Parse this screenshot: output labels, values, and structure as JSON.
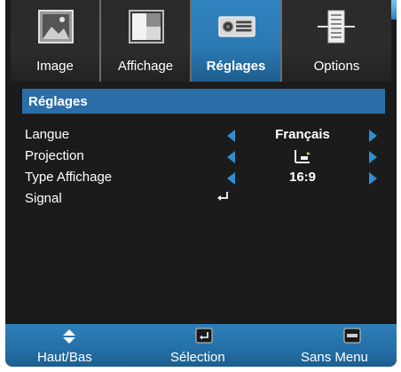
{
  "tabs": [
    {
      "label": "Image",
      "icon": "image-icon",
      "selected": false
    },
    {
      "label": "Affichage",
      "icon": "display-icon",
      "selected": false
    },
    {
      "label": "Réglages",
      "icon": "projector-icon",
      "selected": true
    },
    {
      "label": "Options",
      "icon": "options-icon",
      "selected": false
    }
  ],
  "panel": {
    "title": "Réglages",
    "rows": [
      {
        "label": "Langue",
        "value": "Français"
      },
      {
        "label": "Projection",
        "value": "",
        "value_icon": "projection-icon"
      },
      {
        "label": "Type Affichage",
        "value": "16:9"
      },
      {
        "label": "Signal",
        "value": "",
        "value_icon": "enter-icon"
      }
    ]
  },
  "bottom_bar": {
    "hints": [
      {
        "label": "Haut/Bas",
        "icon": "up-down-icon"
      },
      {
        "label": "Sélection",
        "icon": "enter-key-icon"
      },
      {
        "label": "Sans Menu",
        "icon": "menu-key-icon"
      }
    ]
  },
  "colors": {
    "panel_bg": "#1b1b1b",
    "accent_blue": "#2b6ea7",
    "arrow_blue": "#2f8fd3",
    "tab_selected": "#2f84bf"
  }
}
